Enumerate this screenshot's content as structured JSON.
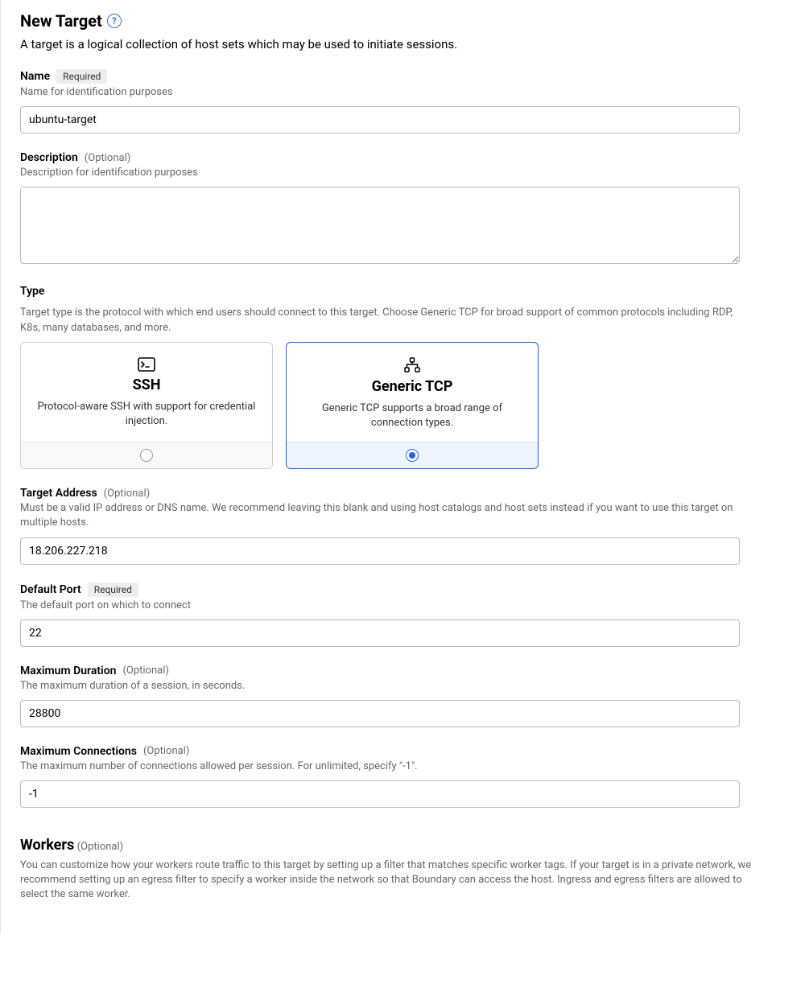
{
  "header": {
    "title": "New Target",
    "subtitle": "A target is a logical collection of host sets which may be used to initiate sessions."
  },
  "fields": {
    "name": {
      "label": "Name",
      "badge": "Required",
      "hint": "Name for identification purposes",
      "value": "ubuntu-target"
    },
    "description": {
      "label": "Description",
      "optional": "(Optional)",
      "hint": "Description for identification purposes",
      "value": ""
    },
    "type": {
      "label": "Type",
      "hint": "Target type is the protocol with which end users should connect to this target. Choose Generic TCP for broad support of common protocols including RDP, K8s, many databases, and more.",
      "options": {
        "ssh": {
          "title": "SSH",
          "desc": "Protocol-aware SSH with support for credential injection.",
          "selected": false
        },
        "tcp": {
          "title": "Generic TCP",
          "desc": "Generic TCP supports a broad range of connection types.",
          "selected": true
        }
      }
    },
    "target_address": {
      "label": "Target Address",
      "optional": "(Optional)",
      "hint": "Must be a valid IP address or DNS name. We recommend leaving this blank and using host catalogs and host sets instead if you want to use this target on multiple hosts.",
      "value": "18.206.227.218"
    },
    "default_port": {
      "label": "Default Port",
      "badge": "Required",
      "hint": "The default port on which to connect",
      "value": "22"
    },
    "max_duration": {
      "label": "Maximum Duration",
      "optional": "(Optional)",
      "hint": "The maximum duration of a session, in seconds.",
      "value": "28800"
    },
    "max_connections": {
      "label": "Maximum Connections",
      "optional": "(Optional)",
      "hint": "The maximum number of connections allowed per session. For unlimited, specify \"-1\".",
      "value": "-1"
    }
  },
  "workers": {
    "title": "Workers",
    "optional": "(Optional)",
    "desc": "You can customize how your workers route traffic to this target by setting up a filter that matches specific worker tags. If your target is in a private network, we recommend setting up an egress filter to specify a worker inside the network so that Boundary can access the host. Ingress and egress filters are allowed to select the same worker."
  }
}
